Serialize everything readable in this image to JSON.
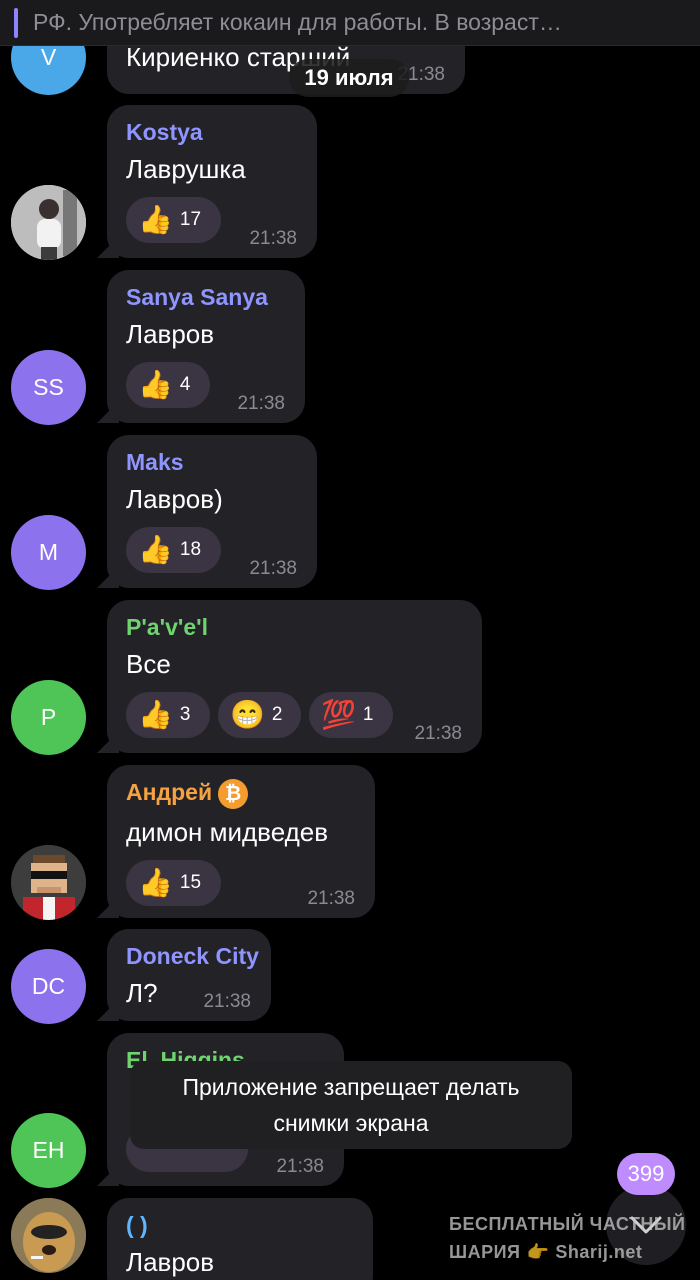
{
  "pinned": {
    "text": "РФ. Употребляет кокаин для работы.  В возраст…"
  },
  "date_separator": "19 июля",
  "colors": {
    "bubble": "#232226",
    "reaction": "#3a3443",
    "unread_badge": "#bf8cff"
  },
  "messages": [
    {
      "avatar_text": "V",
      "avatar_color": "#4aa8e8",
      "text": "Кириенко старший",
      "time": "21:38"
    },
    {
      "sender": "Kostya",
      "sender_color": "#8f95ff",
      "avatar_icon": "person-photo-icon",
      "text": "Лаврушка",
      "reactions": [
        {
          "icon": "thumbs-up-icon",
          "emoji": "👍",
          "count": "17"
        }
      ],
      "time": "21:38"
    },
    {
      "sender": "Sanya Sanya",
      "sender_color": "#8f95ff",
      "avatar_text": "SS",
      "avatar_color": "#8d72ee",
      "text": "Лавров",
      "reactions": [
        {
          "icon": "thumbs-up-icon",
          "emoji": "👍",
          "count": "4"
        }
      ],
      "time": "21:38"
    },
    {
      "sender": "Maks",
      "sender_color": "#8f95ff",
      "avatar_text": "M",
      "avatar_color": "#8d72ee",
      "text": "Лавров)",
      "reactions": [
        {
          "icon": "thumbs-up-icon",
          "emoji": "👍",
          "count": "18"
        }
      ],
      "time": "21:38"
    },
    {
      "sender": "P'a'v'e'l",
      "sender_color": "#6fd36f",
      "avatar_text": "P",
      "avatar_color": "#4fc557",
      "text": "Все",
      "reactions": [
        {
          "icon": "thumbs-up-icon",
          "emoji": "👍",
          "count": "3"
        },
        {
          "icon": "grin-icon",
          "emoji": "😁",
          "count": "2"
        },
        {
          "icon": "hundred-icon",
          "emoji": "💯",
          "count": "1"
        }
      ],
      "time": "21:38"
    },
    {
      "sender": "Андрей",
      "sender_color": "#f5a243",
      "avatar_icon": "pixel-face-icon",
      "text": "димон мидведев",
      "reactions": [
        {
          "icon": "thumbs-up-icon",
          "emoji": "👍",
          "count": "15"
        }
      ],
      "time": "21:38"
    },
    {
      "sender": "Doneck City",
      "sender_color": "#8f95ff",
      "avatar_text": "DC",
      "avatar_color": "#8d72ee",
      "text": "Л?",
      "time": "21:38"
    },
    {
      "sender": "El_Higgins",
      "sender_color": "#6fd36f",
      "avatar_text": "EH",
      "avatar_color": "#4fc557",
      "text": "",
      "time": "21:38"
    },
    {
      "sender": "( )",
      "sender_color": "#5fb6ff",
      "avatar_icon": "dog-photo-icon",
      "text": "Лавров"
    }
  ],
  "toast": {
    "line1": "Приложение запрещает делать",
    "line2": "снимки экрана"
  },
  "unread_count": "399",
  "watermark": {
    "line1": "БЕСПЛАТНЫЙ ЧАСТНЫЙ",
    "line2a": "ШАРИЯ",
    "line2b": "Sharij.net"
  }
}
